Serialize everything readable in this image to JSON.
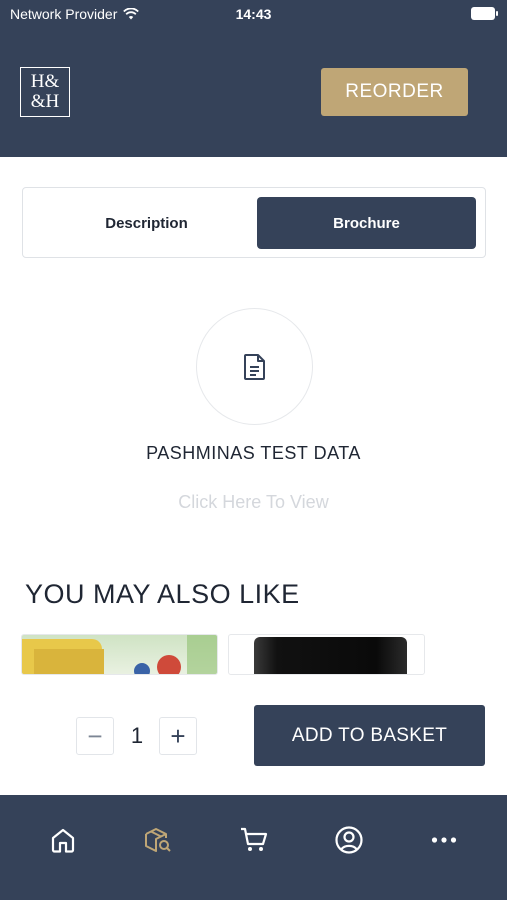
{
  "status_bar": {
    "carrier": "Network Provider",
    "time": "14:43"
  },
  "header": {
    "logo_line1": "H&",
    "logo_line2": "&H",
    "reorder_label": "REORDER"
  },
  "tabs": {
    "description": "Description",
    "brochure": "Brochure",
    "active": "Brochure"
  },
  "brochure": {
    "title": "PASHMINAS TEST DATA",
    "link": "Click Here To View"
  },
  "also_like": {
    "heading": "YOU MAY ALSO LIKE"
  },
  "quantity": {
    "minus": "−",
    "value": "1",
    "plus": "+"
  },
  "basket": {
    "label": "ADD TO BASKET"
  },
  "bottom_nav": {
    "items": [
      {
        "icon": "home-icon"
      },
      {
        "icon": "product-search-icon",
        "active": true
      },
      {
        "icon": "cart-icon"
      },
      {
        "icon": "account-icon"
      },
      {
        "icon": "more-icon"
      }
    ]
  },
  "colors": {
    "navy": "#354259",
    "gold": "#bfa676",
    "muted_text": "#d4d7dc"
  }
}
